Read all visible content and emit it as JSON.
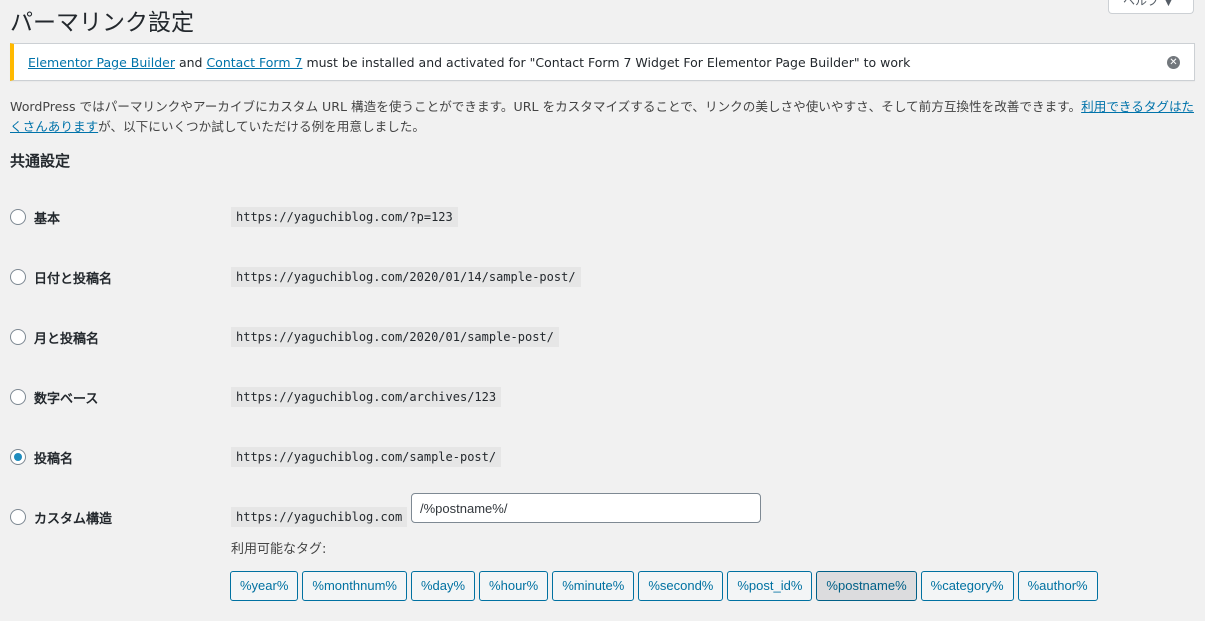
{
  "page": {
    "title": "パーマリンク設定",
    "help_label": "ヘルプ"
  },
  "notice": {
    "link1": "Elementor Page Builder",
    "and": " and ",
    "link2": "Contact Form 7",
    "rest": " must be installed and activated for \"Contact Form 7 Widget For Elementor Page Builder\" to work"
  },
  "intro": {
    "text_before": "WordPress ではパーマリンクやアーカイブにカスタム URL 構造を使うことができます。URL をカスタマイズすることで、リンクの美しさや使いやすさ、そして前方互換性を改善できます。",
    "link": "利用できるタグはたくさんあります",
    "text_after": "が、以下にいくつか試していただける例を用意しました。"
  },
  "section_title": "共通設定",
  "options": [
    {
      "label": "基本",
      "url": "https://yaguchiblog.com/?p=123",
      "checked": false
    },
    {
      "label": "日付と投稿名",
      "url": "https://yaguchiblog.com/2020/01/14/sample-post/",
      "checked": false
    },
    {
      "label": "月と投稿名",
      "url": "https://yaguchiblog.com/2020/01/sample-post/",
      "checked": false
    },
    {
      "label": "数字ベース",
      "url": "https://yaguchiblog.com/archives/123",
      "checked": false
    },
    {
      "label": "投稿名",
      "url": "https://yaguchiblog.com/sample-post/",
      "checked": true
    },
    {
      "label": "カスタム構造",
      "url": "https://yaguchiblog.com",
      "checked": false
    }
  ],
  "custom_structure_value": "/%postname%/",
  "tags_label": "利用可能なタグ:",
  "tags": [
    "%year%",
    "%monthnum%",
    "%day%",
    "%hour%",
    "%minute%",
    "%second%",
    "%post_id%",
    "%postname%",
    "%category%",
    "%author%"
  ],
  "active_tag": "%postname%",
  "colors": {
    "link": "#0073aa",
    "notice_border": "#ffb900",
    "radio_checked": "#1e8cbe",
    "tag_border": "#0071a1"
  }
}
